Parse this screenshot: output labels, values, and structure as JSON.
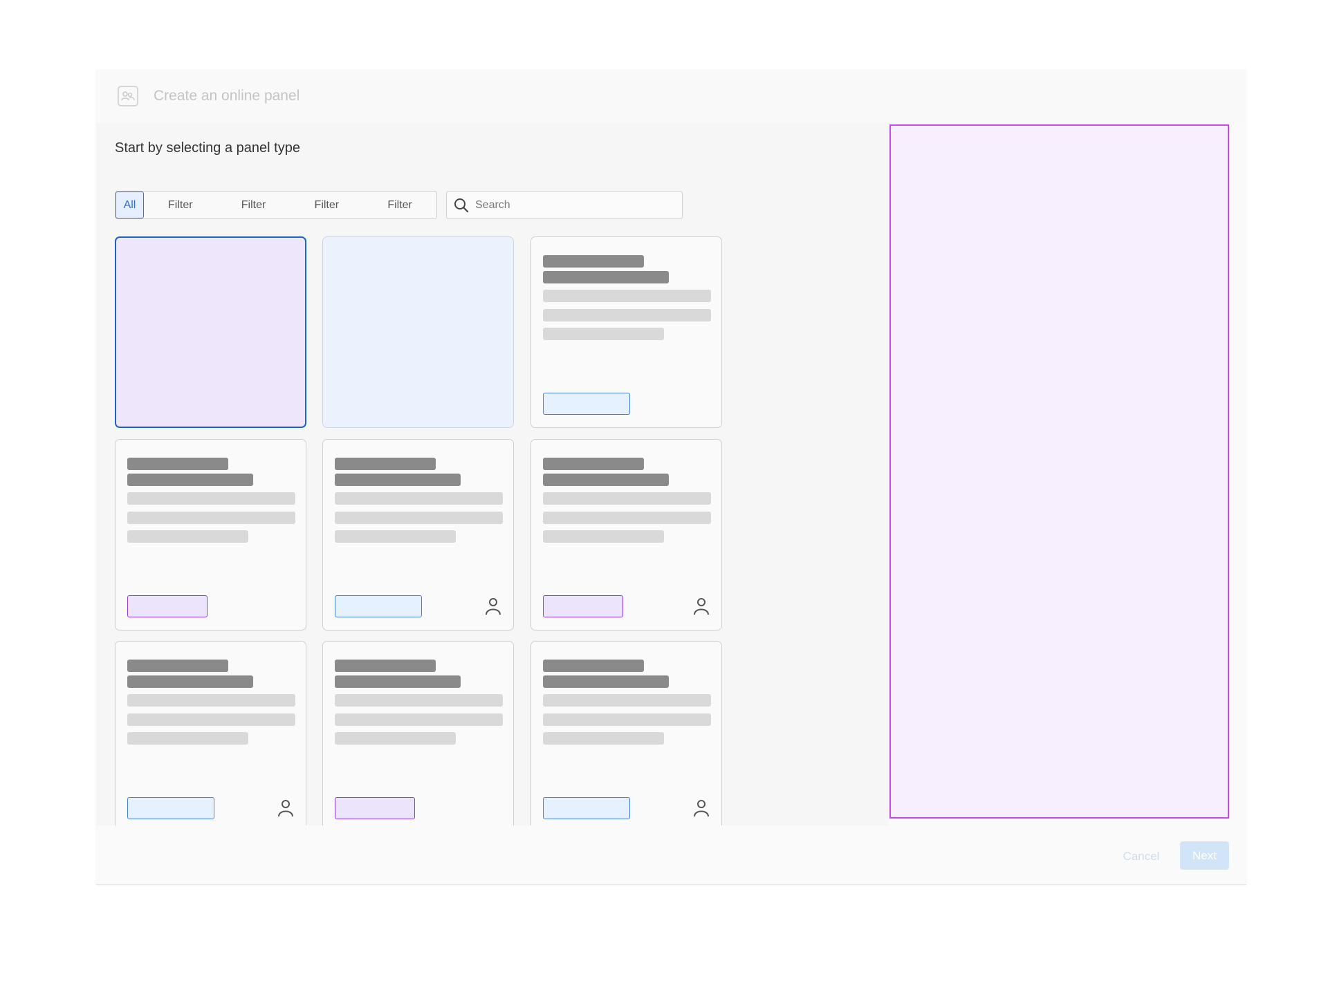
{
  "dialog": {
    "title": "Create an online panel",
    "header_icon": "user-group-icon"
  },
  "main": {
    "heading": "Start by selecting a panel type",
    "filters": {
      "active": "All",
      "chips": [
        "Filter",
        "Filter",
        "Filter",
        "Filter"
      ]
    },
    "search": {
      "placeholder": "Search",
      "icon": "search-icon"
    },
    "cards": [
      {
        "state": "selected",
        "fill": "#eee7fb",
        "skeleton": false
      },
      {
        "state": "highlighted",
        "fill": "#ebf2fd",
        "skeleton": false
      },
      {
        "state": "default",
        "skeleton": true,
        "tag": "blue",
        "user_icon": false
      },
      {
        "state": "default",
        "skeleton": true,
        "tag": "purple",
        "user_icon": false
      },
      {
        "state": "default",
        "skeleton": true,
        "tag": "blue",
        "user_icon": true
      },
      {
        "state": "default",
        "skeleton": true,
        "tag": "purple",
        "user_icon": true
      },
      {
        "state": "default",
        "skeleton": true,
        "tag": "blue",
        "user_icon": true
      },
      {
        "state": "default",
        "skeleton": true,
        "tag": "purple",
        "user_icon": false
      },
      {
        "state": "default",
        "skeleton": true,
        "tag": "blue",
        "user_icon": true
      }
    ]
  },
  "preview_panel": {
    "border_color": "#c24be6",
    "fill": "#f7effd"
  },
  "footer": {
    "cancel_label": "Cancel",
    "next_label": "Next"
  },
  "colors": {
    "accent_blue": "#1c63c6",
    "accent_purple": "#8a3ed6"
  }
}
